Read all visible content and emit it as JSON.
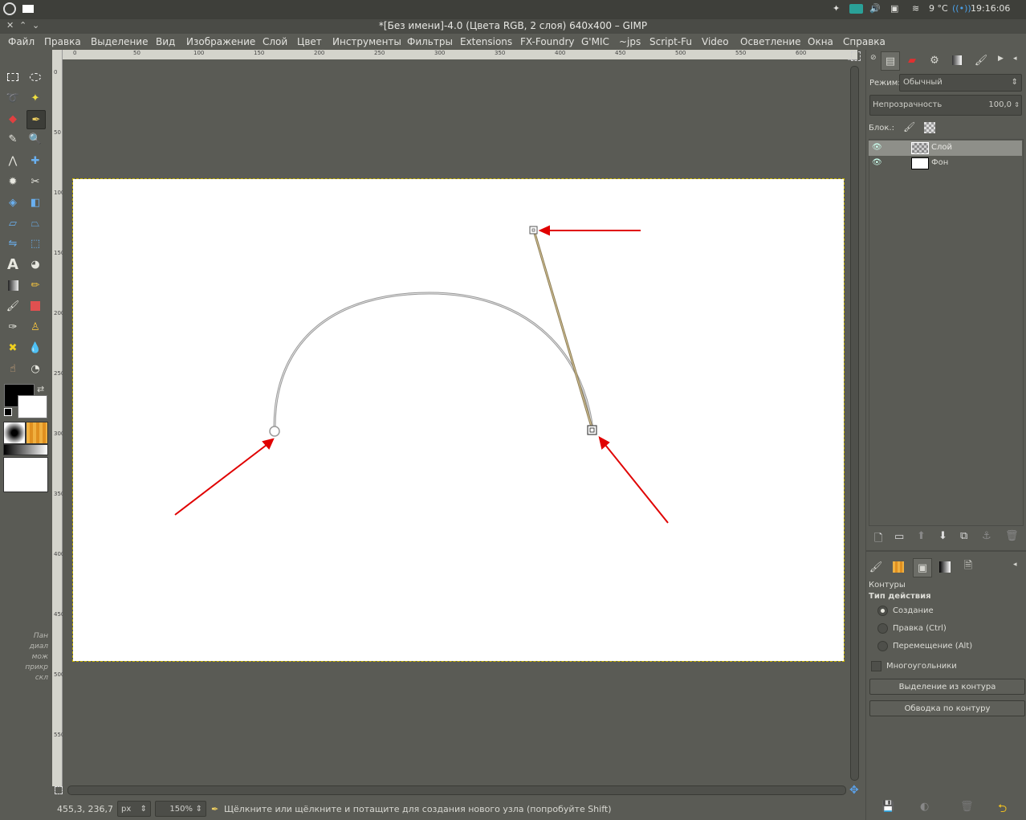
{
  "app": {
    "title": "*[Без имени]-4.0 (Цвета RGB, 2 слоя) 640x400 – GIMP"
  },
  "system_tray": {
    "temperature": "9 °C",
    "time": "19:16:06"
  },
  "menu": [
    "Файл",
    "Правка",
    "Выделение",
    "Вид",
    "Изображение",
    "Слой",
    "Цвет",
    "Инструменты",
    "Фильтры",
    "Extensions",
    "FX-Foundry",
    "G'MIC",
    "~jps",
    "Script-Fu",
    "Video",
    "Осветление",
    "Окна",
    "Справка"
  ],
  "ruler": {
    "h_ticks": [
      "0",
      "50",
      "100",
      "150",
      "200",
      "250",
      "300",
      "350",
      "400",
      "450",
      "500",
      "550",
      "600"
    ],
    "v_ticks": [
      "0",
      "50",
      "100",
      "150",
      "200",
      "250",
      "300",
      "350",
      "400",
      "450",
      "500",
      "550"
    ]
  },
  "toolbox_hint": {
    "line1": "Пан",
    "line2": "диал",
    "line3": "мож",
    "line4": "прикр",
    "line5": "скл"
  },
  "status": {
    "coords": "455,3, 236,7",
    "unit": "px",
    "zoom": "150%",
    "message": "Щёлкните или щёлкните и потащите для создания нового узла (попробуйте Shift)"
  },
  "layers_panel": {
    "mode_label": "Режим:",
    "mode_value": "Обычный",
    "opacity_label": "Непрозрачность",
    "opacity_value": "100,0",
    "lock_label": "Блок.:",
    "layers": [
      {
        "name": "Слой",
        "selected": true
      },
      {
        "name": "Фон",
        "selected": false
      }
    ]
  },
  "tool_options": {
    "tool_name": "Контуры",
    "section_label": "Тип действия",
    "modes": [
      {
        "label": "Создание",
        "checked": true
      },
      {
        "label": "Правка (Ctrl)",
        "checked": false
      },
      {
        "label": "Перемещение (Alt)",
        "checked": false
      }
    ],
    "polygon_label": "Многоугольники",
    "polygon_checked": false,
    "btn_selection": "Выделение из контура",
    "btn_stroke": "Обводка по контуру"
  },
  "colors": {
    "arrow": "#e00000",
    "tangent": "#b8a070",
    "selection_border": "#c8b400",
    "accent_orange": "#f0a020"
  }
}
